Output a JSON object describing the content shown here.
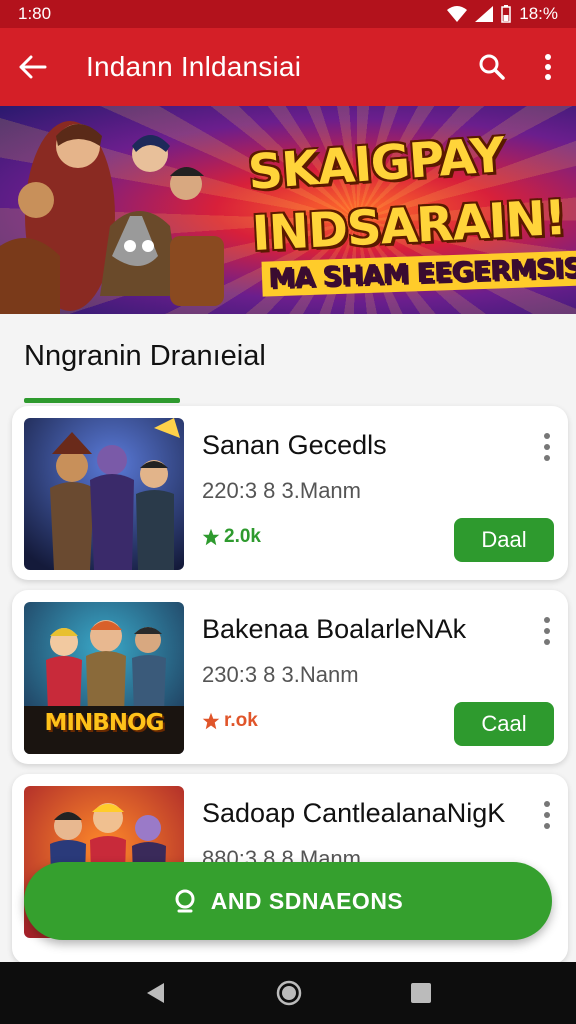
{
  "status": {
    "time": "1:80",
    "battery": "18:%"
  },
  "appbar": {
    "title": "Indann Inldansiai"
  },
  "banner": {
    "line1": "SKAIGPAY",
    "line2": "INDSARAIN!",
    "line3": "MA SHAM EEGERMSIS"
  },
  "section": {
    "title": "Nngranin Dranıeial"
  },
  "apps": [
    {
      "name": "Sanan Gecedls",
      "meta": "220:3 8 3.Manm",
      "rating": "2.0k",
      "rating_color": "#2e9a2e",
      "button": "Daal"
    },
    {
      "name": "Bakenaa BoalarleNAk",
      "meta": "230:3 8 3.Nanm",
      "rating": "r.ok",
      "rating_color": "#e0552a",
      "button": "Caal",
      "thumb_text": "MINBNOG"
    },
    {
      "name": "Sadoap CantlealanaNigK",
      "meta": "880:3 8 8.Manm"
    }
  ],
  "fab": {
    "label": "AND SDNAEONS"
  },
  "colors": {
    "primary": "#d41f27",
    "status": "#b3121c",
    "accent": "#2e9a2e"
  }
}
